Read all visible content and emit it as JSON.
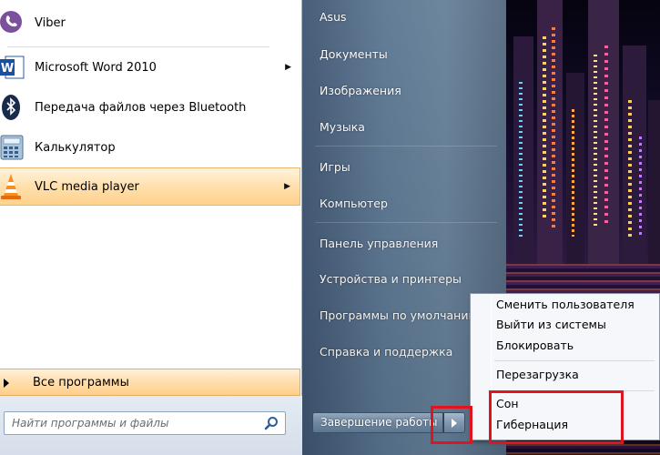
{
  "programs": [
    {
      "label": "Viber",
      "icon": "viber-icon",
      "has_submenu": false
    },
    {
      "label": "Microsoft Word 2010",
      "icon": "word-icon",
      "has_submenu": true
    },
    {
      "label": "Передача файлов через Bluetooth",
      "icon": "bluetooth-icon",
      "has_submenu": false
    },
    {
      "label": "Калькулятор",
      "icon": "calculator-icon",
      "has_submenu": false
    },
    {
      "label": "VLC media player",
      "icon": "vlc-icon",
      "has_submenu": true,
      "highlighted": true
    }
  ],
  "all_programs_label": "Все программы",
  "search": {
    "placeholder": "Найти программы и файлы"
  },
  "right_items": [
    "Asus",
    "Документы",
    "Изображения",
    "Музыка",
    "Игры",
    "Компьютер",
    "Панель управления",
    "Устройства и принтеры",
    "Программы по умолчанию",
    "Справка и поддержка"
  ],
  "shutdown": {
    "label": "Завершение работы"
  },
  "power_menu": {
    "group1": [
      "Сменить пользователя",
      "Выйти из системы",
      "Блокировать"
    ],
    "group2": [
      "Перезагрузка"
    ],
    "group3": [
      "Сон",
      "Гибернация"
    ]
  },
  "colors": {
    "highlight_red": "#e0141e",
    "hover_orange": "#ffdca8",
    "right_pane": "#5a7590"
  }
}
